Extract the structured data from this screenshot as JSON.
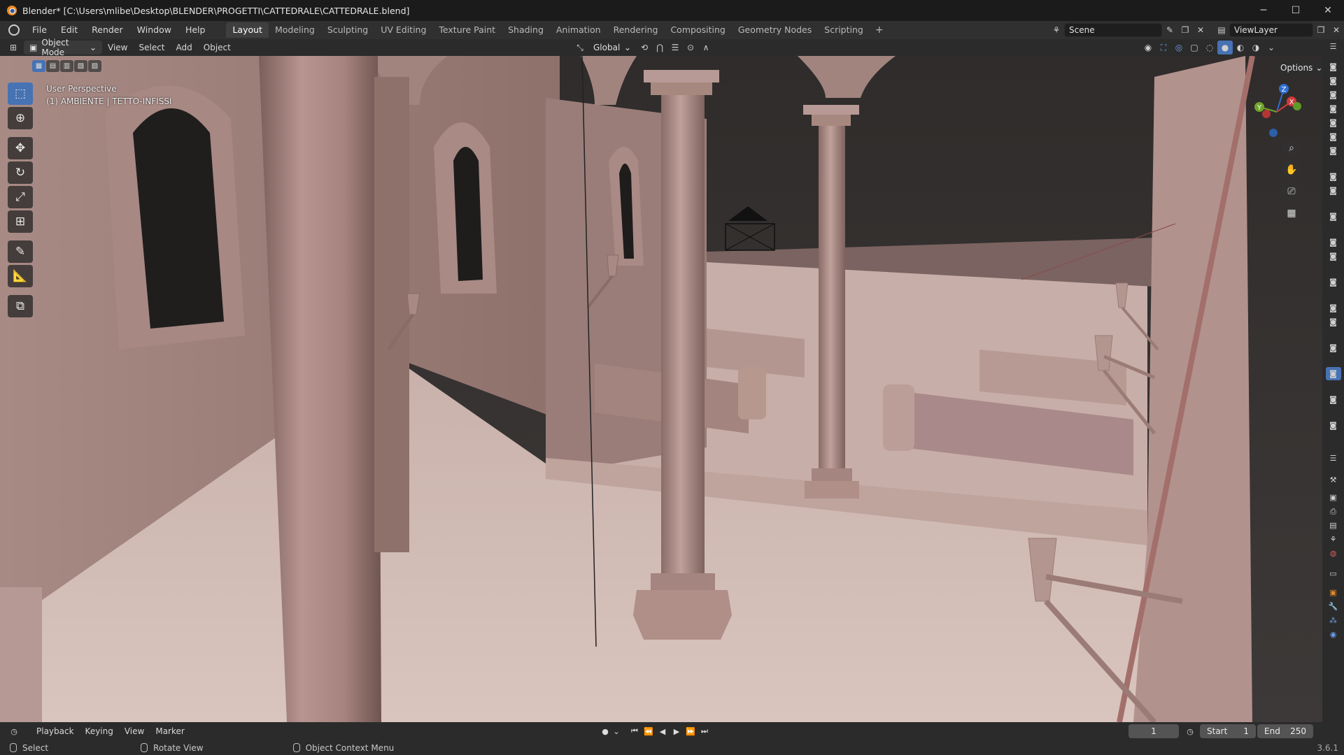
{
  "window": {
    "title": "Blender* [C:\\Users\\mlibe\\Desktop\\BLENDER\\PROGETTI\\CATTEDRALE\\CATTEDRALE.blend]",
    "controls": [
      "─",
      "☐",
      "✕"
    ]
  },
  "menu": [
    "File",
    "Edit",
    "Render",
    "Window",
    "Help"
  ],
  "workspaces": {
    "tabs": [
      "Layout",
      "Modeling",
      "Sculpting",
      "UV Editing",
      "Texture Paint",
      "Shading",
      "Animation",
      "Rendering",
      "Compositing",
      "Geometry Nodes",
      "Scripting"
    ],
    "active": "Layout",
    "add": "+"
  },
  "scene": {
    "name": "Scene"
  },
  "view_layer": {
    "name": "ViewLayer"
  },
  "viewport_header": {
    "mode": "Object Mode",
    "menus": [
      "View",
      "Select",
      "Add",
      "Object"
    ],
    "orientation": "Global"
  },
  "viewport": {
    "perspective": "User Perspective",
    "collection": "(1) AMBIENTE | TETTO-INFISSI",
    "options": "Options",
    "gizmo": {
      "x": "X",
      "y": "Y",
      "z": "Z"
    }
  },
  "colors": {
    "accent": "#4772b3",
    "wall": "#9a7b76",
    "floor": "#c6aca6",
    "sky": "#3a3635"
  },
  "timeline": {
    "menus": [
      "Playback",
      "Keying",
      "View",
      "Marker"
    ],
    "current_frame": "1",
    "start_label": "Start",
    "start": "1",
    "end_label": "End",
    "end": "250"
  },
  "statusbar": {
    "items": [
      "Select",
      "Rotate View",
      "Object Context Menu"
    ],
    "version": "3.6.1"
  }
}
